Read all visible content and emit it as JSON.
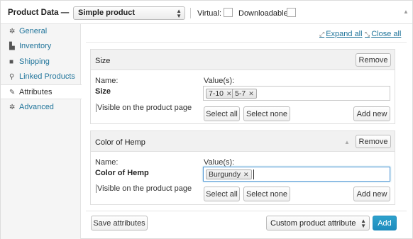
{
  "header": {
    "title": "Product Data —",
    "product_type": "Simple product",
    "virtual_label": "Virtual:",
    "downloadable_label": "Downloadable:"
  },
  "sidebar": {
    "items": [
      {
        "label": "General",
        "icon": "gear-icon"
      },
      {
        "label": "Inventory",
        "icon": "inventory-icon"
      },
      {
        "label": "Shipping",
        "icon": "truck-icon"
      },
      {
        "label": "Linked Products",
        "icon": "link-icon"
      },
      {
        "label": "Attributes",
        "icon": "wrench-icon",
        "active": true
      },
      {
        "label": "Advanced",
        "icon": "gear-icon"
      }
    ]
  },
  "toolbar": {
    "expand_all": "Expand all",
    "close_all": "Close all"
  },
  "attributes": [
    {
      "title": "Size",
      "remove_label": "Remove",
      "name_label": "Name:",
      "name_value": "Size",
      "values_label": "Value(s):",
      "values": [
        "7-10",
        "5-7"
      ],
      "visible_label": "Visible on the product page",
      "select_all": "Select all",
      "select_none": "Select none",
      "add_new": "Add new"
    },
    {
      "title": "Color of Hemp",
      "remove_label": "Remove",
      "name_label": "Name:",
      "name_value": "Color of Hemp",
      "values_label": "Value(s):",
      "values": [
        "Burgundy"
      ],
      "visible_label": "Visible on the product page",
      "select_all": "Select all",
      "select_none": "Select none",
      "add_new": "Add new"
    }
  ],
  "footer": {
    "save_label": "Save attributes",
    "attribute_type": "Custom product attribute",
    "add_label": "Add"
  },
  "colors": {
    "link": "#21759b",
    "primary_button": "#2ea2cc",
    "sidebar_bg": "#f5f5f5",
    "attr_header_bg": "#f1f1f1"
  }
}
